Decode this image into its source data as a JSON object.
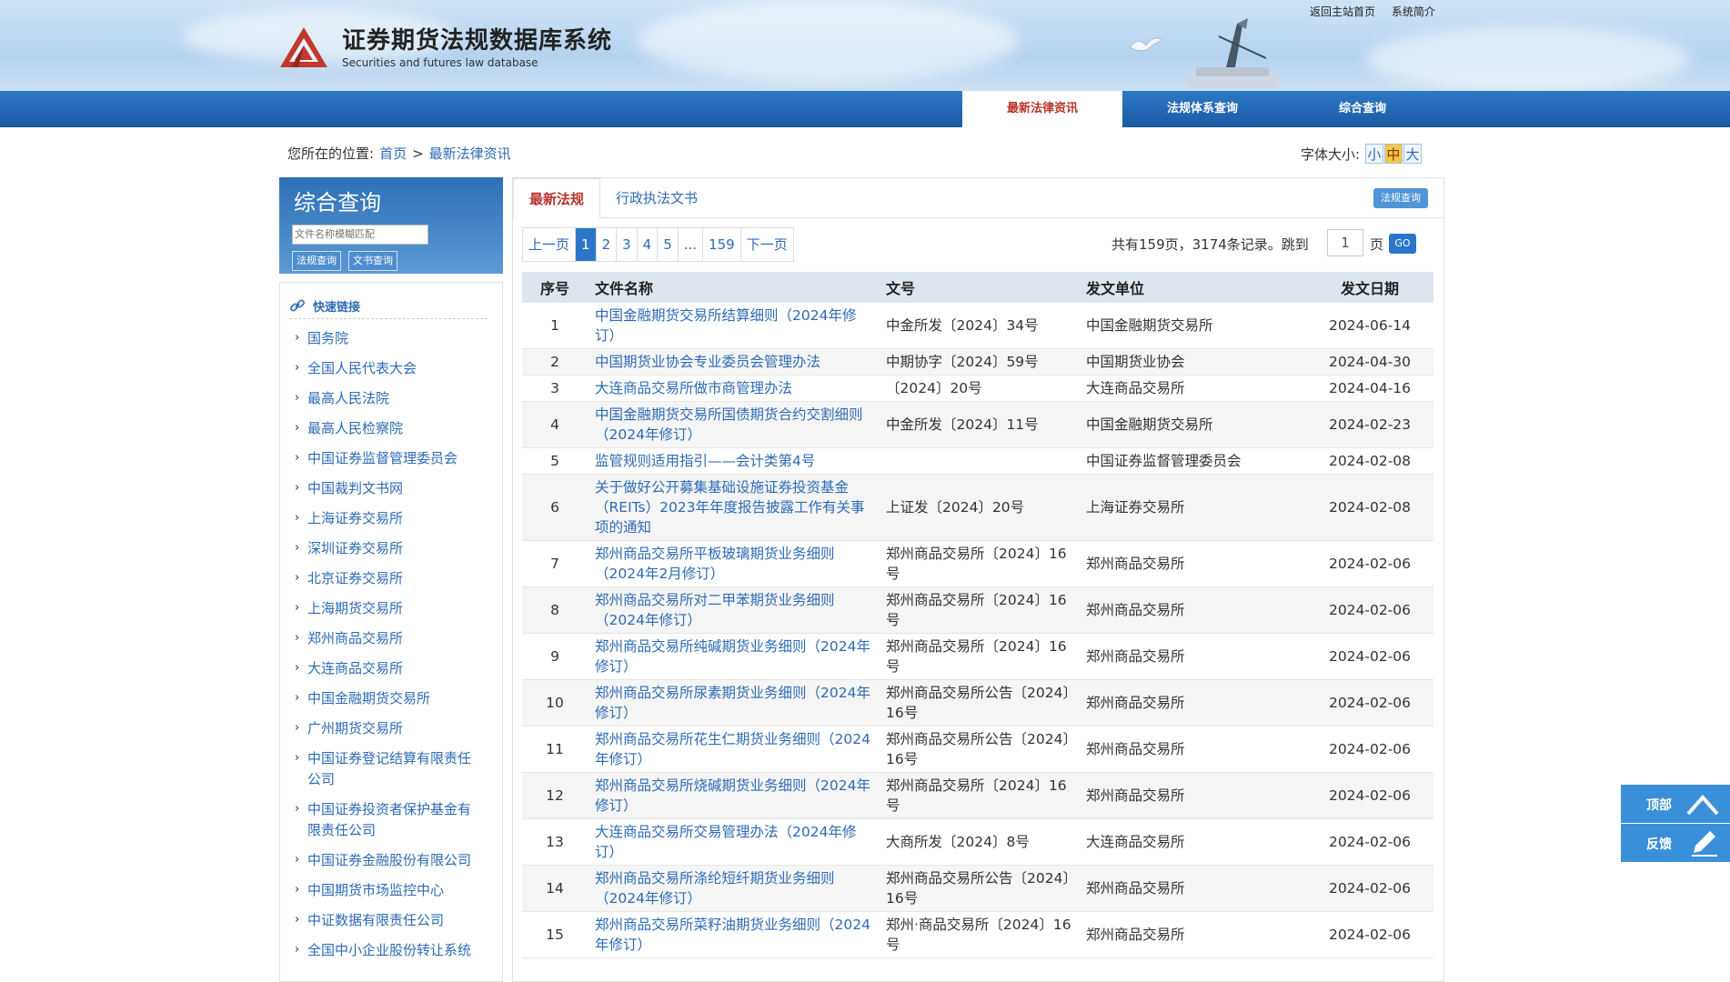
{
  "header": {
    "title": "证券期货法规数据库系统",
    "subtitle": "Securities and futures law database",
    "top_links": [
      "返回主站首页",
      "系统简介"
    ]
  },
  "nav": {
    "tabs": [
      {
        "label": "最新法律资讯",
        "active": true
      },
      {
        "label": "法规体系查询",
        "active": false
      },
      {
        "label": "综合查询",
        "active": false
      }
    ]
  },
  "breadcrumb": {
    "prefix": "您所在的位置:",
    "home": "首页",
    "separator": ">",
    "current": "最新法律资讯"
  },
  "font_size": {
    "label": "字体大小:",
    "options": [
      "小",
      "中",
      "大"
    ],
    "selected": "中"
  },
  "search": {
    "title": "综合查询",
    "placeholder": "文件名称模糊匹配",
    "regulation_button": "法规查询",
    "document_button": "文书查询"
  },
  "quick_links": {
    "title": "快速链接",
    "items": [
      "国务院",
      "全国人民代表大会",
      "最高人民法院",
      "最高人民检察院",
      "中国证券监督管理委员会",
      "中国裁判文书网",
      "上海证券交易所",
      "深圳证券交易所",
      "北京证券交易所",
      "上海期货交易所",
      "郑州商品交易所",
      "大连商品交易所",
      "中国金融期货交易所",
      "广州期货交易所",
      "中国证券登记结算有限责任公司",
      "中国证券投资者保护基金有限责任公司",
      "中国证券金融股份有限公司",
      "中国期货市场监控中心",
      "中证数据有限责任公司",
      "全国中小企业股份转让系统"
    ]
  },
  "main_tabs": {
    "active": "最新法规",
    "inactive": "行政执法文书",
    "query_button": "法规查询"
  },
  "pagination": {
    "prev": "上一页",
    "pages": [
      "1",
      "2",
      "3",
      "4",
      "5",
      "...",
      "159"
    ],
    "current": "1",
    "next": "下一页",
    "summary": "共有159页，3174条记录。跳到",
    "jump_value": "1",
    "page_unit": "页",
    "go": "GO"
  },
  "table": {
    "headers": [
      "序号",
      "文件名称",
      "文号",
      "发文单位",
      "发文日期"
    ],
    "rows": [
      {
        "no": "1",
        "title": "中国金融期货交易所结算细则（2024年修订）",
        "doc": "中金所发〔2024〕34号",
        "unit": "中国金融期货交易所",
        "date": "2024-06-14"
      },
      {
        "no": "2",
        "title": "中国期货业协会专业委员会管理办法",
        "doc": "中期协字〔2024〕59号",
        "unit": "中国期货业协会",
        "date": "2024-04-30"
      },
      {
        "no": "3",
        "title": "大连商品交易所做市商管理办法",
        "doc": "〔2024〕20号",
        "unit": "大连商品交易所",
        "date": "2024-04-16"
      },
      {
        "no": "4",
        "title": "中国金融期货交易所国债期货合约交割细则（2024年修订）",
        "doc": "中金所发〔2024〕11号",
        "unit": "中国金融期货交易所",
        "date": "2024-02-23"
      },
      {
        "no": "5",
        "title": "监管规则适用指引——会计类第4号",
        "doc": "",
        "unit": "中国证券监督管理委员会",
        "date": "2024-02-08"
      },
      {
        "no": "6",
        "title": "关于做好公开募集基础设施证券投资基金（REITs）2023年年度报告披露工作有关事项的通知",
        "doc": "上证发〔2024〕20号",
        "unit": "上海证券交易所",
        "date": "2024-02-08"
      },
      {
        "no": "7",
        "title": "郑州商品交易所平板玻璃期货业务细则（2024年2月修订）",
        "doc": "郑州商品交易所〔2024〕16号",
        "unit": "郑州商品交易所",
        "date": "2024-02-06"
      },
      {
        "no": "8",
        "title": "郑州商品交易所对二甲苯期货业务细则（2024年修订）",
        "doc": "郑州商品交易所〔2024〕16号",
        "unit": "郑州商品交易所",
        "date": "2024-02-06"
      },
      {
        "no": "9",
        "title": "郑州商品交易所纯碱期货业务细则（2024年修订）",
        "doc": "郑州商品交易所〔2024〕16号",
        "unit": "郑州商品交易所",
        "date": "2024-02-06"
      },
      {
        "no": "10",
        "title": "郑州商品交易所尿素期货业务细则（2024年修订）",
        "doc": "郑州商品交易所公告〔2024〕16号",
        "unit": "郑州商品交易所",
        "date": "2024-02-06"
      },
      {
        "no": "11",
        "title": "郑州商品交易所花生仁期货业务细则（2024年修订）",
        "doc": "郑州商品交易所公告〔2024〕16号",
        "unit": "郑州商品交易所",
        "date": "2024-02-06"
      },
      {
        "no": "12",
        "title": "郑州商品交易所烧碱期货业务细则（2024年修订）",
        "doc": "郑州商品交易所〔2024〕16号",
        "unit": "郑州商品交易所",
        "date": "2024-02-06"
      },
      {
        "no": "13",
        "title": "大连商品交易所交易管理办法（2024年修订）",
        "doc": "大商所发〔2024〕8号",
        "unit": "大连商品交易所",
        "date": "2024-02-06"
      },
      {
        "no": "14",
        "title": "郑州商品交易所涤纶短纤期货业务细则（2024年修订）",
        "doc": "郑州商品交易所公告〔2024〕16号",
        "unit": "郑州商品交易所",
        "date": "2024-02-06"
      },
      {
        "no": "15",
        "title": "郑州商品交易所菜籽油期货业务细则（2024年修订）",
        "doc": "郑州·商品交易所〔2024〕16号",
        "unit": "郑州商品交易所",
        "date": "2024-02-06"
      }
    ]
  },
  "float": {
    "top": "顶部",
    "feedback": "反馈"
  },
  "colors": {
    "nav_blue": "#1a5aa3",
    "link_blue": "#2d6bb5",
    "active_red": "#b8342a",
    "logo_red": "#c0392b"
  }
}
